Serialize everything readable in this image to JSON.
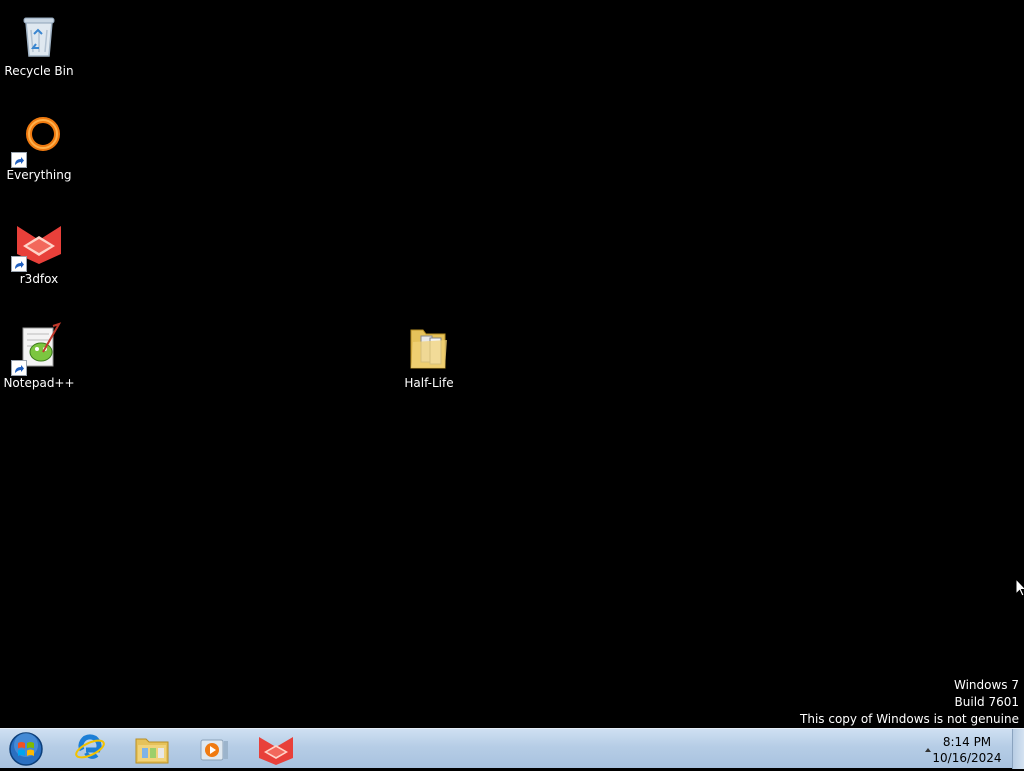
{
  "desktop": {
    "icons": [
      {
        "label": "Recycle Bin",
        "icon": "recycle-bin-icon"
      },
      {
        "label": "Everything",
        "icon": "everything-icon",
        "shortcut": true
      },
      {
        "label": "r3dfox",
        "icon": "r3dfox-icon",
        "shortcut": true
      },
      {
        "label": "Notepad++",
        "icon": "notepadpp-icon",
        "shortcut": true
      },
      {
        "label": "Half-Life",
        "icon": "folder-icon"
      }
    ],
    "watermark": {
      "line1": "Windows 7",
      "line2": "Build 7601",
      "line3": "This copy of Windows is not genuine"
    }
  },
  "taskbar": {
    "start": "start-orb-icon",
    "pinned": [
      "internet-explorer-icon",
      "file-explorer-icon",
      "media-player-icon",
      "r3dfox-icon"
    ],
    "clock": {
      "time": "8:14 PM",
      "date": "10/16/2024"
    }
  },
  "colors": {
    "desktop_bg": "#000000",
    "taskbar_top": "#cfe0f2",
    "taskbar_bottom": "#a8c2df",
    "accent_orange": "#f07a10",
    "accent_red": "#e8403a"
  }
}
